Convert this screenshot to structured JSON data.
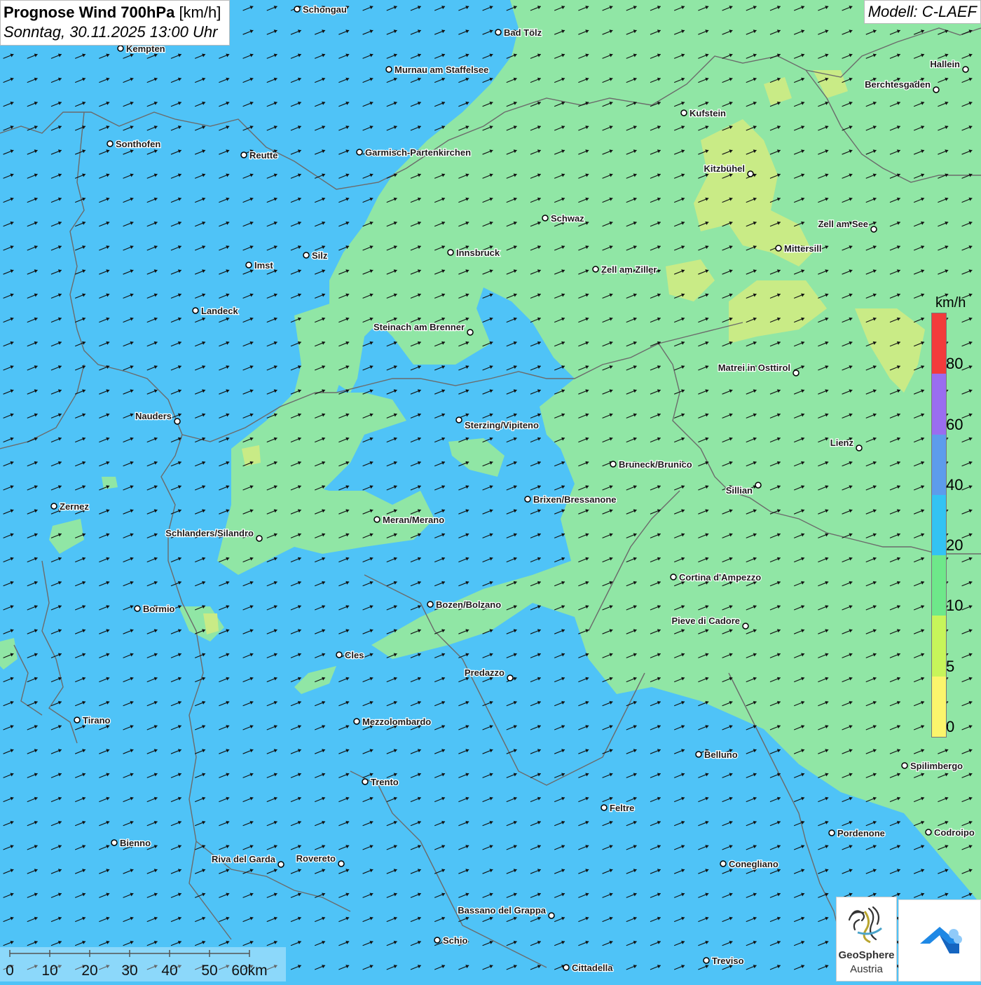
{
  "title": {
    "main_bold": "Prognose Wind 700hPa",
    "main_unit": "[km/h]",
    "date": "Sonntag, 30.11.2025 13:00 Uhr"
  },
  "model": "Modell: C-LAEF",
  "legend": {
    "unit": "km/h",
    "labels": [
      "80",
      "60",
      "40",
      "20",
      "10",
      "5",
      "0"
    ],
    "colors": [
      "#f23b3b",
      "#9a6df0",
      "#5d9cec",
      "#33c3f3",
      "#6ee88a",
      "#c7f55a",
      "#fbf56c"
    ]
  },
  "colors": {
    "wind_20_40": "#4fc3f7",
    "wind_10_20": "#90e6a5",
    "wind_5_10": "#c9eb86",
    "border": "#666666",
    "arrow": "#111111"
  },
  "map": {
    "wind_direction": "from west-southwest",
    "cities": [
      {
        "name": "Schongau"
      },
      {
        "name": "Bad Tölz"
      },
      {
        "name": "Kempten"
      },
      {
        "name": "Murnau am Staffelsee"
      },
      {
        "name": "Hallein"
      },
      {
        "name": "Berchtesgaden"
      },
      {
        "name": "Kufstein"
      },
      {
        "name": "Sonthofen"
      },
      {
        "name": "Reutte"
      },
      {
        "name": "Garmisch-Partenkirchen"
      },
      {
        "name": "Kitzbühel"
      },
      {
        "name": "Schwaz"
      },
      {
        "name": "Zell am See"
      },
      {
        "name": "Mittersill"
      },
      {
        "name": "Innsbruck"
      },
      {
        "name": "Silz"
      },
      {
        "name": "Imst"
      },
      {
        "name": "Zell am Ziller"
      },
      {
        "name": "Landeck"
      },
      {
        "name": "Steinach am Brenner"
      },
      {
        "name": "Matrei in Osttirol"
      },
      {
        "name": "Nauders"
      },
      {
        "name": "Sterzing/Vipiteno"
      },
      {
        "name": "Lienz"
      },
      {
        "name": "Bruneck/Brunico"
      },
      {
        "name": "Sillian"
      },
      {
        "name": "Zernez"
      },
      {
        "name": "Brixen/Bressanone"
      },
      {
        "name": "Meran/Merano"
      },
      {
        "name": "Schlanders/Silandro"
      },
      {
        "name": "Cortina d'Ampezzo"
      },
      {
        "name": "Bormio"
      },
      {
        "name": "Bozen/Bolzano"
      },
      {
        "name": "Pieve di Cadore"
      },
      {
        "name": "Cles"
      },
      {
        "name": "Predazzo"
      },
      {
        "name": "Tirano"
      },
      {
        "name": "Mezzolombardo"
      },
      {
        "name": "Belluno"
      },
      {
        "name": "Spilimbergo"
      },
      {
        "name": "Trento"
      },
      {
        "name": "Feltre"
      },
      {
        "name": "Pordenone"
      },
      {
        "name": "Codroipo"
      },
      {
        "name": "Bienno"
      },
      {
        "name": "Riva del Garda"
      },
      {
        "name": "Rovereto"
      },
      {
        "name": "Conegliano"
      },
      {
        "name": "Bassano del Grappa"
      },
      {
        "name": "Schio"
      },
      {
        "name": "Treviso"
      },
      {
        "name": "Cittadella"
      }
    ]
  },
  "scale_bar": {
    "labels": [
      "0",
      "10",
      "20",
      "30",
      "40",
      "50",
      "60km"
    ]
  },
  "logos": {
    "geosphere_line1": "GeoSphere",
    "geosphere_line2": "Austria"
  }
}
